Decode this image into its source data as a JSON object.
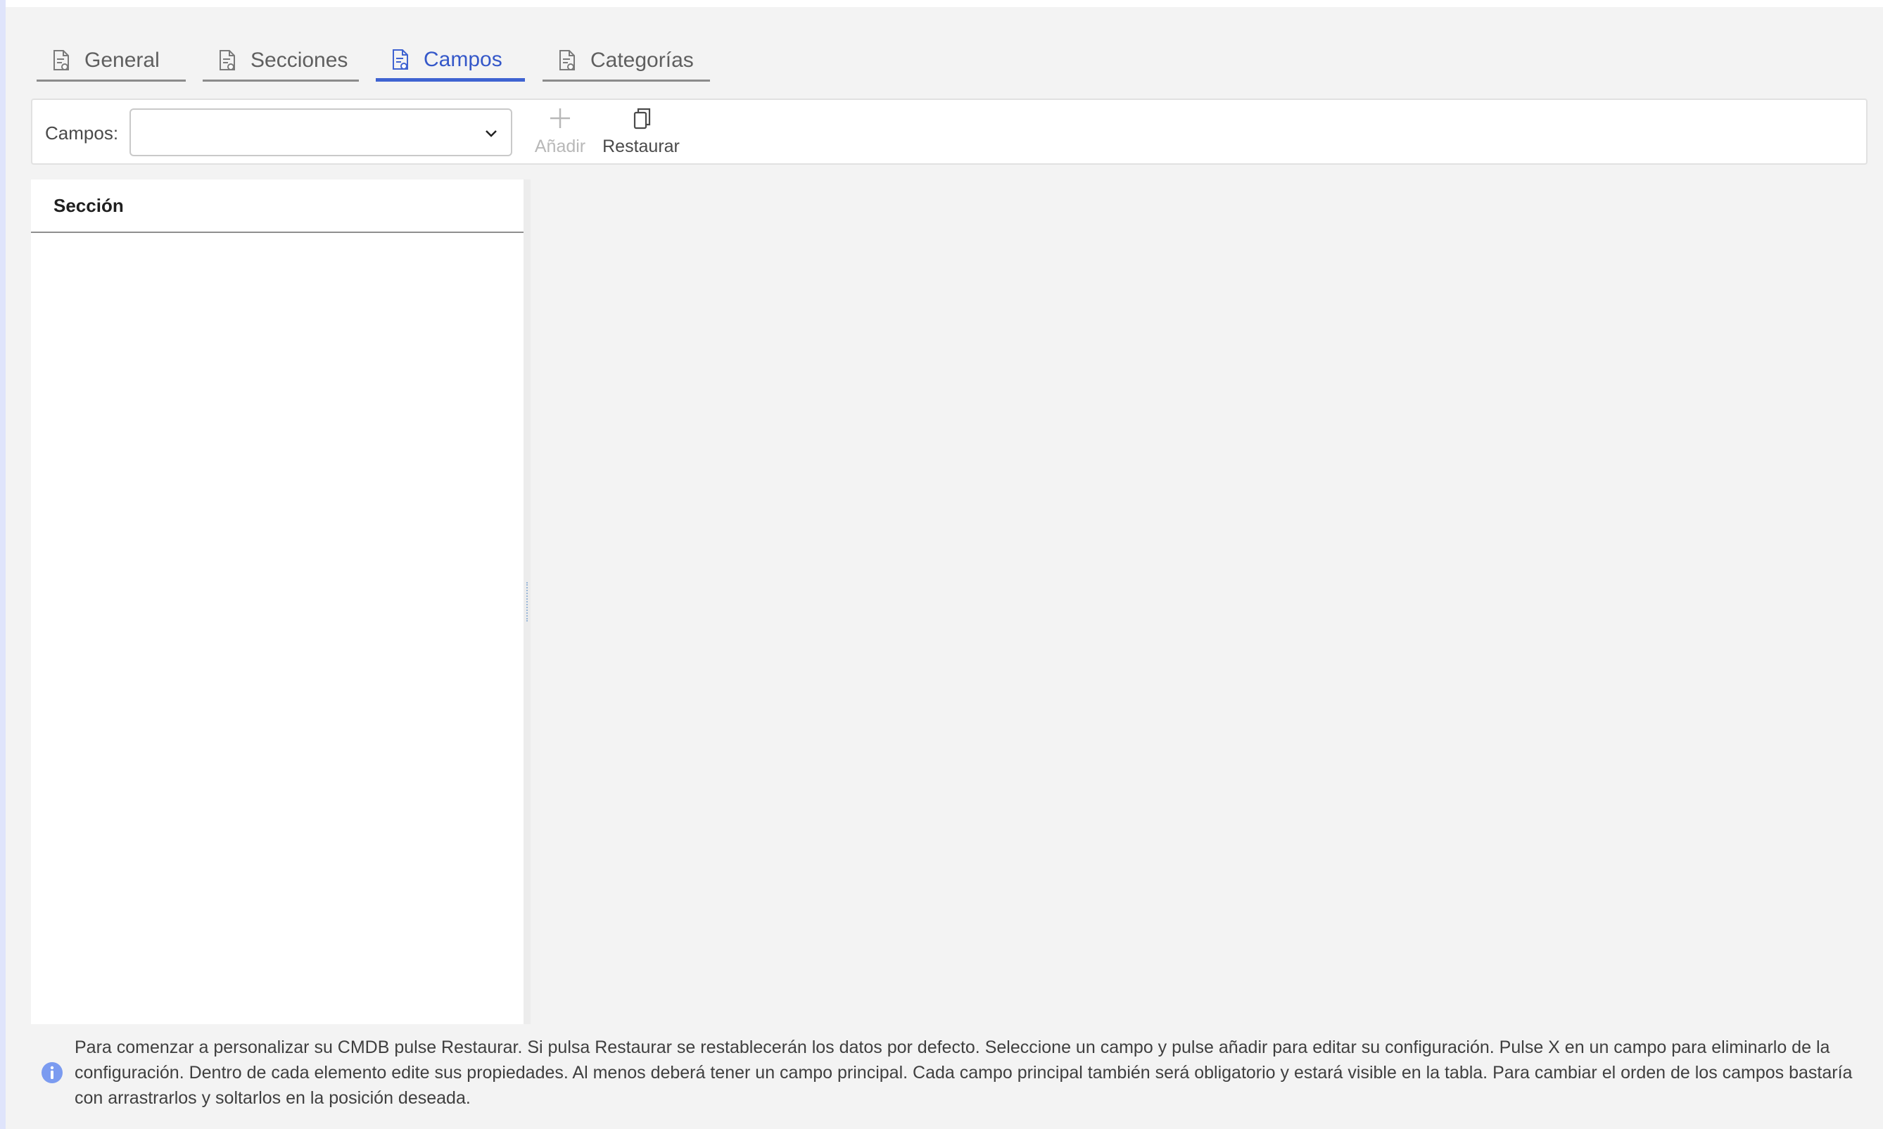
{
  "tabs": [
    {
      "label": "General",
      "icon": "document-settings-icon",
      "active": false
    },
    {
      "label": "Secciones",
      "icon": "document-settings-icon",
      "active": false
    },
    {
      "label": "Campos",
      "icon": "document-settings-icon",
      "active": true
    },
    {
      "label": "Categorías",
      "icon": "document-settings-icon",
      "active": false
    }
  ],
  "toolbar": {
    "campos_label": "Campos:",
    "campos_value": "",
    "add_label": "Añadir",
    "restore_label": "Restaurar"
  },
  "section_panel": {
    "header": "Sección"
  },
  "info": {
    "text": "Para comenzar a personalizar su CMDB pulse Restaurar. Si pulsa Restaurar se restablecerán los datos por defecto. Seleccione un campo y pulse añadir para editar su configuración. Pulse X en un campo para eliminarlo de la configuración. Dentro de cada elemento edite sus propiedades. Al menos deberá tener un campo principal. Cada campo principal también será obligatorio y estará visible en la tabla. Para cambiar el orden de los campos bastaría con arrastrarlos y soltarlos en la posición deseada."
  },
  "colors": {
    "accent": "#3f63d1",
    "background": "#f3f3f3",
    "info_icon": "#7b9bf0"
  }
}
